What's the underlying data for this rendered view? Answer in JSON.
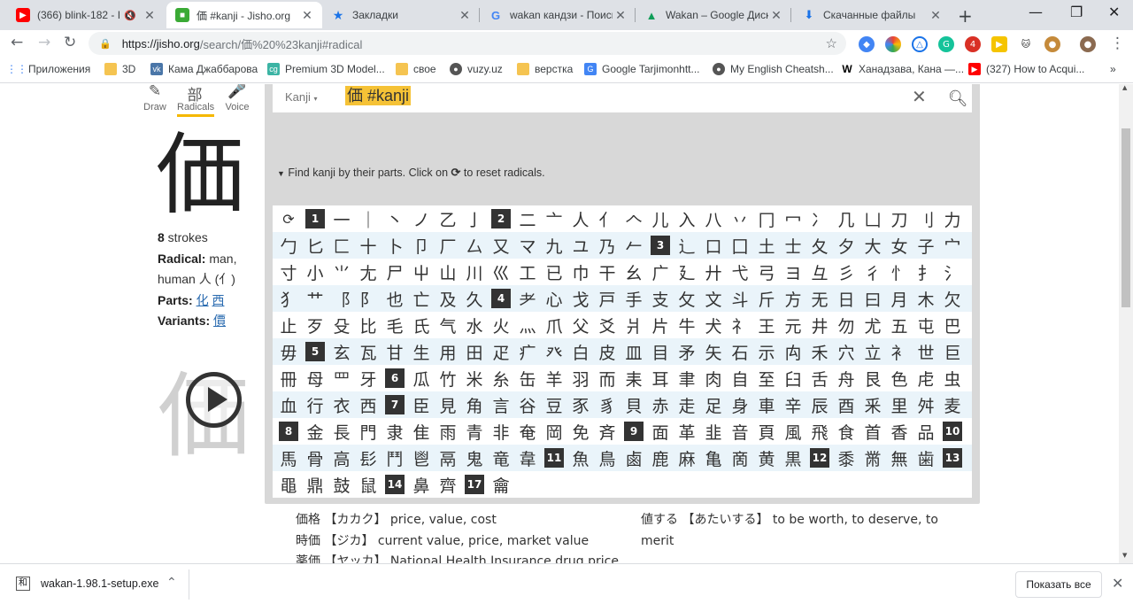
{
  "tabs": [
    {
      "title": "(366) blink-182 - I M",
      "icon": "youtube-icon",
      "color": "#ff0000"
    },
    {
      "title": "価 #kanji - Jisho.org",
      "icon": "jisho-icon",
      "color": "#3aaa35"
    },
    {
      "title": "Закладки",
      "icon": "star-icon",
      "color": "#1a73e8"
    },
    {
      "title": "wakan кандзи - Поиск",
      "icon": "google-icon",
      "color": "#4285f4"
    },
    {
      "title": "Wakan – Google Диск",
      "icon": "google-drive-icon",
      "color": "#0f9d58"
    },
    {
      "title": "Скачанные файлы",
      "icon": "download-icon",
      "color": "#1a73e8"
    }
  ],
  "address": {
    "host": "https://jisho.org",
    "path": "/search/価%20%23kanji#radical"
  },
  "bookmarks": [
    {
      "label": "Приложения",
      "icon": "apps-grid-icon"
    },
    {
      "label": "3D",
      "icon": "folder-icon"
    },
    {
      "label": "Кама Джаббарова",
      "icon": "vk-icon"
    },
    {
      "label": "Premium 3D Model...",
      "icon": "cgtrader-icon"
    },
    {
      "label": "свое",
      "icon": "folder-icon"
    },
    {
      "label": "vuzy.uz",
      "icon": "globe-icon"
    },
    {
      "label": "верстка",
      "icon": "folder-icon"
    },
    {
      "label": "Google Tarjimonhtt...",
      "icon": "google-translate-icon"
    },
    {
      "label": "My English Cheatsh...",
      "icon": "globe-icon"
    },
    {
      "label": "Ханадзава, Кана —...",
      "icon": "wikipedia-icon"
    },
    {
      "label": "(327) How to Acqui...",
      "icon": "youtube-icon"
    }
  ],
  "modes": {
    "draw": "Draw",
    "radicals": "Radicals",
    "voice": "Voice"
  },
  "kanji": {
    "char": "価",
    "strokes_num": "8",
    "strokes_label": " strokes",
    "radical_label": "Radical:",
    "radical_value": " man, human 人 (亻)",
    "parts_label": "Parts:",
    "parts": [
      "化",
      "西"
    ],
    "variants_label": "Variants:",
    "variants": [
      "價"
    ]
  },
  "search": {
    "type_label": "Kanji",
    "query": "価 #kanji"
  },
  "find_text_pre": "Find kanji by their parts. Click on",
  "find_text_post": "to reset radicals.",
  "radical_rows": [
    [
      "↻",
      "#1",
      "一",
      "｜",
      "丶",
      "ノ",
      "乙",
      "亅",
      "#2",
      "二",
      "亠",
      "人",
      "亻",
      "𠆢",
      "儿",
      "入",
      "八",
      "丷",
      "冂",
      "冖",
      "冫",
      "几",
      "凵",
      "刀",
      "刂",
      "力"
    ],
    [
      "勹",
      "匕",
      "匚",
      "十",
      "卜",
      "卩",
      "厂",
      "厶",
      "又",
      "マ",
      "九",
      "ユ",
      "乃",
      "𠂉",
      "#3",
      "⻌",
      "口",
      "囗",
      "土",
      "士",
      "夂",
      "夕",
      "大",
      "女",
      "子",
      "宀"
    ],
    [
      "寸",
      "小",
      "⺌",
      "尢",
      "尸",
      "屮",
      "山",
      "川",
      "巛",
      "工",
      "已",
      "巾",
      "干",
      "幺",
      "广",
      "廴",
      "廾",
      "弋",
      "弓",
      "ヨ",
      "彑",
      "彡",
      "彳",
      "忄",
      "扌",
      "氵"
    ],
    [
      "犭",
      "艹",
      "⻏",
      "⻖",
      "也",
      "亡",
      "及",
      "久",
      "#4",
      "耂",
      "心",
      "戈",
      "戸",
      "手",
      "支",
      "攵",
      "文",
      "斗",
      "斤",
      "方",
      "无",
      "日",
      "曰",
      "月",
      "木",
      "欠"
    ],
    [
      "止",
      "歹",
      "殳",
      "比",
      "毛",
      "氏",
      "气",
      "水",
      "火",
      "灬",
      "爪",
      "父",
      "爻",
      "爿",
      "片",
      "牛",
      "犬",
      "礻",
      "王",
      "元",
      "井",
      "勿",
      "尤",
      "五",
      "屯",
      "巴"
    ],
    [
      "毋",
      "#5",
      "玄",
      "瓦",
      "甘",
      "生",
      "用",
      "田",
      "疋",
      "疒",
      "癶",
      "白",
      "皮",
      "皿",
      "目",
      "矛",
      "矢",
      "石",
      "示",
      "禸",
      "禾",
      "穴",
      "立",
      "衤",
      "世",
      "巨"
    ],
    [
      "冊",
      "母",
      "罒",
      "牙",
      "#6",
      "瓜",
      "竹",
      "米",
      "糸",
      "缶",
      "羊",
      "羽",
      "而",
      "耒",
      "耳",
      "聿",
      "肉",
      "自",
      "至",
      "臼",
      "舌",
      "舟",
      "艮",
      "色",
      "虍",
      "虫"
    ],
    [
      "血",
      "行",
      "衣",
      "西",
      "#7",
      "臣",
      "見",
      "角",
      "言",
      "谷",
      "豆",
      "豕",
      "豸",
      "貝",
      "赤",
      "走",
      "足",
      "身",
      "車",
      "辛",
      "辰",
      "酉",
      "釆",
      "里",
      "舛",
      "麦"
    ],
    [
      "#8",
      "金",
      "長",
      "門",
      "隶",
      "隹",
      "雨",
      "青",
      "非",
      "奄",
      "岡",
      "免",
      "斉",
      "#9",
      "面",
      "革",
      "韭",
      "音",
      "頁",
      "風",
      "飛",
      "食",
      "首",
      "香",
      "品",
      "#10"
    ],
    [
      "馬",
      "骨",
      "高",
      "髟",
      "鬥",
      "鬯",
      "鬲",
      "鬼",
      "竜",
      "韋",
      "#11",
      "魚",
      "鳥",
      "鹵",
      "鹿",
      "麻",
      "亀",
      "啇",
      "黄",
      "黒",
      "#12",
      "黍",
      "黹",
      "無",
      "歯",
      "#13"
    ],
    [
      "黽",
      "鼎",
      "鼓",
      "鼠",
      "#14",
      "鼻",
      "齊",
      "#17",
      "龠"
    ]
  ],
  "compounds_left": [
    "価格 【カカク】 price, value, cost",
    "時価 【ジカ】 current value, price, market value",
    "薬価 【ヤッカ】 National Health Insurance drug price"
  ],
  "compounds_right": [
    "値する 【あたいする】 to be worth, to deserve, to",
    "merit"
  ],
  "download": {
    "filename": "wakan-1.98.1-setup.exe",
    "show_all": "Показать все"
  }
}
